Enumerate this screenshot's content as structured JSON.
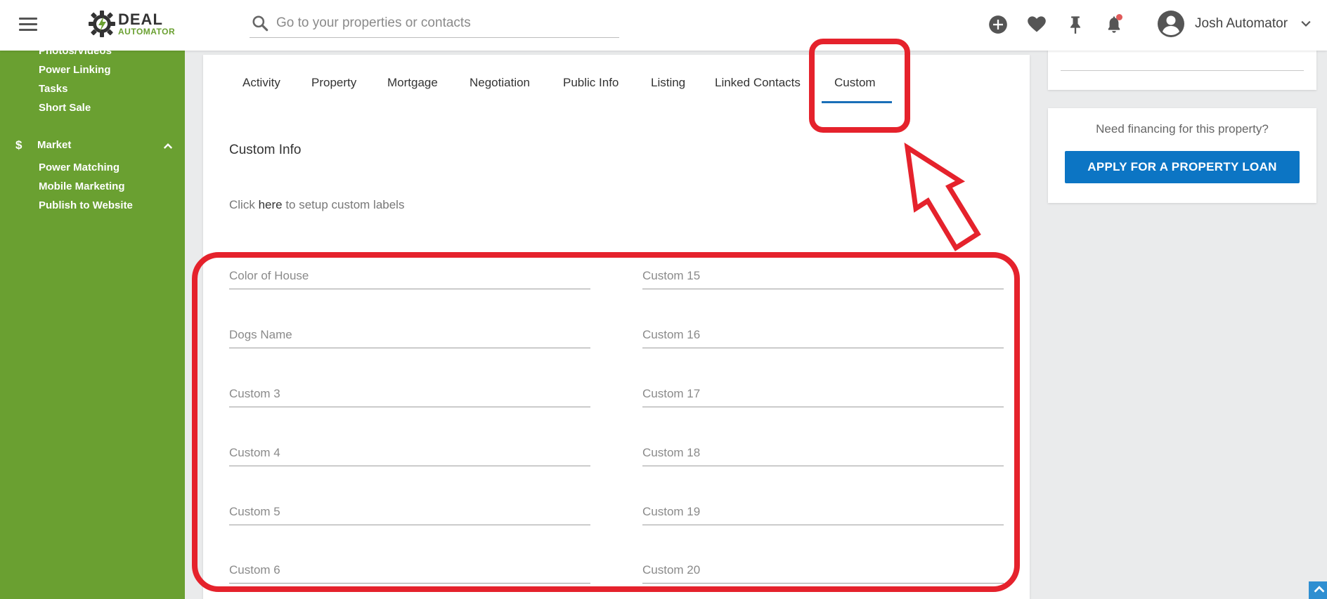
{
  "header": {
    "logo_word1": "DEAL",
    "logo_word2": "AUTOMATOR",
    "search_placeholder": "Go to your properties or contacts",
    "user_name": "Josh Automator"
  },
  "sidebar": {
    "items_top": [
      {
        "label": "Photos/Videos"
      },
      {
        "label": "Power Linking"
      },
      {
        "label": "Tasks"
      },
      {
        "label": "Short Sale"
      }
    ],
    "market_section": {
      "icon_glyph": "$",
      "label": "Market"
    },
    "items_market": [
      {
        "label": "Power Matching"
      },
      {
        "label": "Mobile Marketing"
      },
      {
        "label": "Publish to Website"
      }
    ]
  },
  "tabs": [
    {
      "label": "Activity"
    },
    {
      "label": "Property"
    },
    {
      "label": "Mortgage"
    },
    {
      "label": "Negotiation"
    },
    {
      "label": "Public Info"
    },
    {
      "label": "Listing"
    },
    {
      "label": "Linked Contacts"
    },
    {
      "label": "Custom",
      "active": true
    }
  ],
  "custom_info": {
    "title": "Custom Info",
    "hint_before": "Click ",
    "hint_link": "here",
    "hint_after": " to setup custom labels",
    "left_fields": [
      {
        "placeholder": "Color of House"
      },
      {
        "placeholder": "Dogs Name"
      },
      {
        "placeholder": "Custom 3"
      },
      {
        "placeholder": "Custom 4"
      },
      {
        "placeholder": "Custom 5"
      },
      {
        "placeholder": "Custom 6"
      }
    ],
    "right_fields": [
      {
        "placeholder": "Custom 15"
      },
      {
        "placeholder": "Custom 16"
      },
      {
        "placeholder": "Custom 17"
      },
      {
        "placeholder": "Custom 18"
      },
      {
        "placeholder": "Custom 19"
      },
      {
        "placeholder": "Custom 20"
      }
    ]
  },
  "financing": {
    "question": "Need financing for this property?",
    "button_label": "APPLY FOR A PROPERTY LOAN"
  },
  "colors": {
    "sidebar_green": "#6aa031",
    "primary_blue": "#0c75c4",
    "annotation_red": "#e5222c"
  }
}
